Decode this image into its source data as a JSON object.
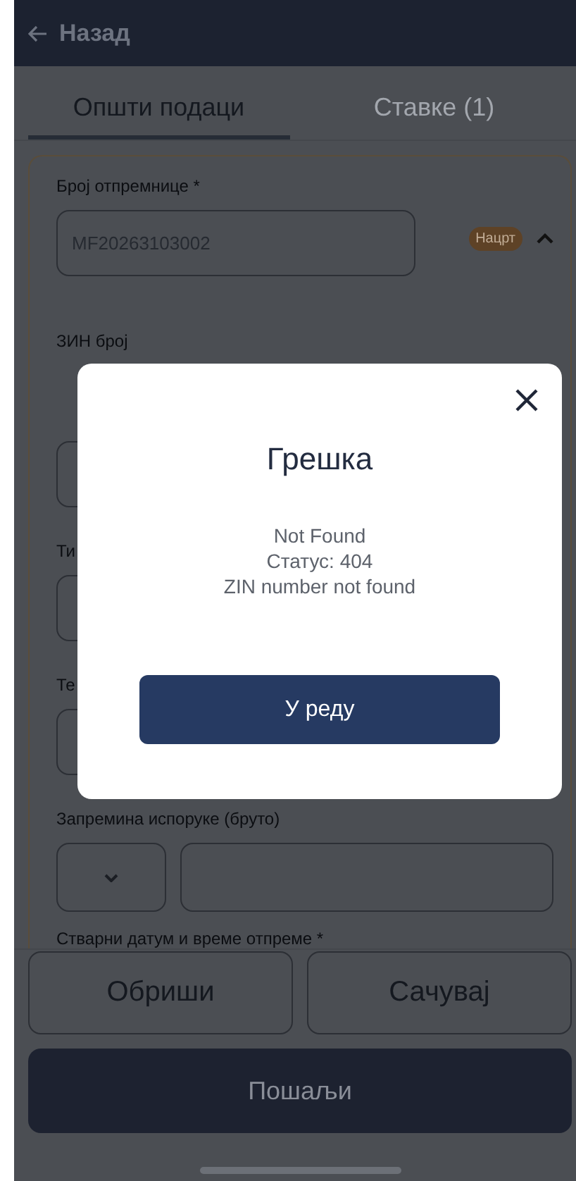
{
  "header": {
    "back_label": "Назад"
  },
  "tabs": [
    {
      "label": "Општи подаци",
      "selected": true
    },
    {
      "label": "Ставке (1)",
      "selected": false
    }
  ],
  "form": {
    "badge": "Нацрт",
    "expanded": true,
    "fields": [
      {
        "kind": "text",
        "label": "Број отпремнице *",
        "value": "MF20263103002"
      },
      {
        "kind": "text",
        "label": "ЗИН број"
      },
      {
        "kind": "text",
        "label": "Ти"
      },
      {
        "kind": "text",
        "label": "Те"
      },
      {
        "kind": "unit",
        "label": "Запремина испоруке (бруто)"
      },
      {
        "kind": "label",
        "label": "Стварни датум и време отпреме *"
      }
    ]
  },
  "actions": {
    "delete": "Обриши",
    "save": "Сачувај",
    "send": "Пошаљи"
  },
  "dialog": {
    "title": "Грешка",
    "message_lines": [
      "Not Found",
      "Статус: 404",
      "ZIN number not found"
    ],
    "ok": "У реду"
  }
}
